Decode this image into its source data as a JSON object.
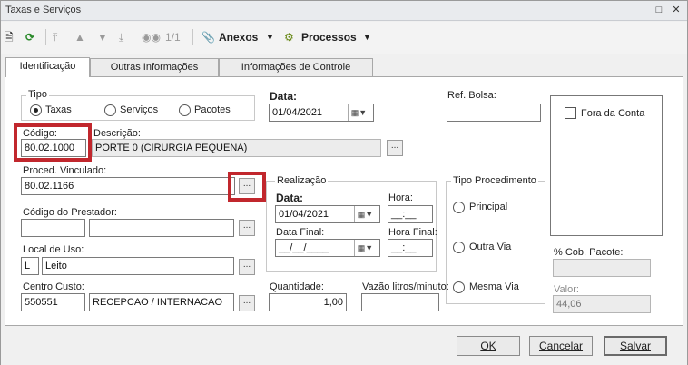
{
  "window": {
    "title": "Taxas e Serviços"
  },
  "toolbar": {
    "page_indicator": "1/1",
    "anexos_label": "Anexos",
    "processos_label": "Processos"
  },
  "tabs": [
    {
      "label": "Identificação",
      "active": true
    },
    {
      "label": "Outras Informações",
      "active": false
    },
    {
      "label": "Informações de Controle",
      "active": false
    }
  ],
  "tipo": {
    "label": "Tipo",
    "options": [
      "Taxas",
      "Serviços",
      "Pacotes"
    ],
    "selected": "Taxas"
  },
  "data": {
    "label": "Data:",
    "value": "01/04/2021"
  },
  "ref_bolsa": {
    "label": "Ref. Bolsa:",
    "value": ""
  },
  "fora_da_conta": {
    "label": "Fora da Conta",
    "checked": false
  },
  "codigo": {
    "label": "Código:",
    "value": "80.02.1000"
  },
  "descricao": {
    "label": "Descrição:",
    "value": "PORTE 0 (CIRURGIA PEQUENA)"
  },
  "proced_vinculado": {
    "label": "Proced. Vinculado:",
    "value": "80.02.1166"
  },
  "realizacao": {
    "title": "Realização",
    "data_label": "Data:",
    "data_value": "01/04/2021",
    "hora_label": "Hora:",
    "hora_value": "__:__",
    "data_final_label": "Data Final:",
    "data_final_value": "__/__/____",
    "hora_final_label": "Hora Final:",
    "hora_final_value": "__:__"
  },
  "tipo_procedimento": {
    "title": "Tipo Procedimento",
    "options": [
      "Principal",
      "Outra Via",
      "Mesma Via"
    ]
  },
  "codigo_prestador": {
    "label": "Código do Prestador:",
    "code": "",
    "name": ""
  },
  "local_uso": {
    "label": "Local de Uso:",
    "code": "L",
    "name": "Leito"
  },
  "centro_custo": {
    "label": "Centro Custo:",
    "code": "550551",
    "name": "RECEPCAO / INTERNACAO"
  },
  "quantidade": {
    "label": "Quantidade:",
    "value": "1,00"
  },
  "vazao": {
    "label": "Vazão litros/minuto:",
    "value": ""
  },
  "cob_pacote": {
    "label": "% Cob. Pacote:",
    "value": ""
  },
  "valor": {
    "label": "Valor:",
    "value": "44,06"
  },
  "buttons": {
    "ok": "OK",
    "cancelar": "Cancelar",
    "salvar": "Salvar"
  },
  "ellipsis": "...",
  "colors": {
    "highlight": "#c1272d"
  }
}
